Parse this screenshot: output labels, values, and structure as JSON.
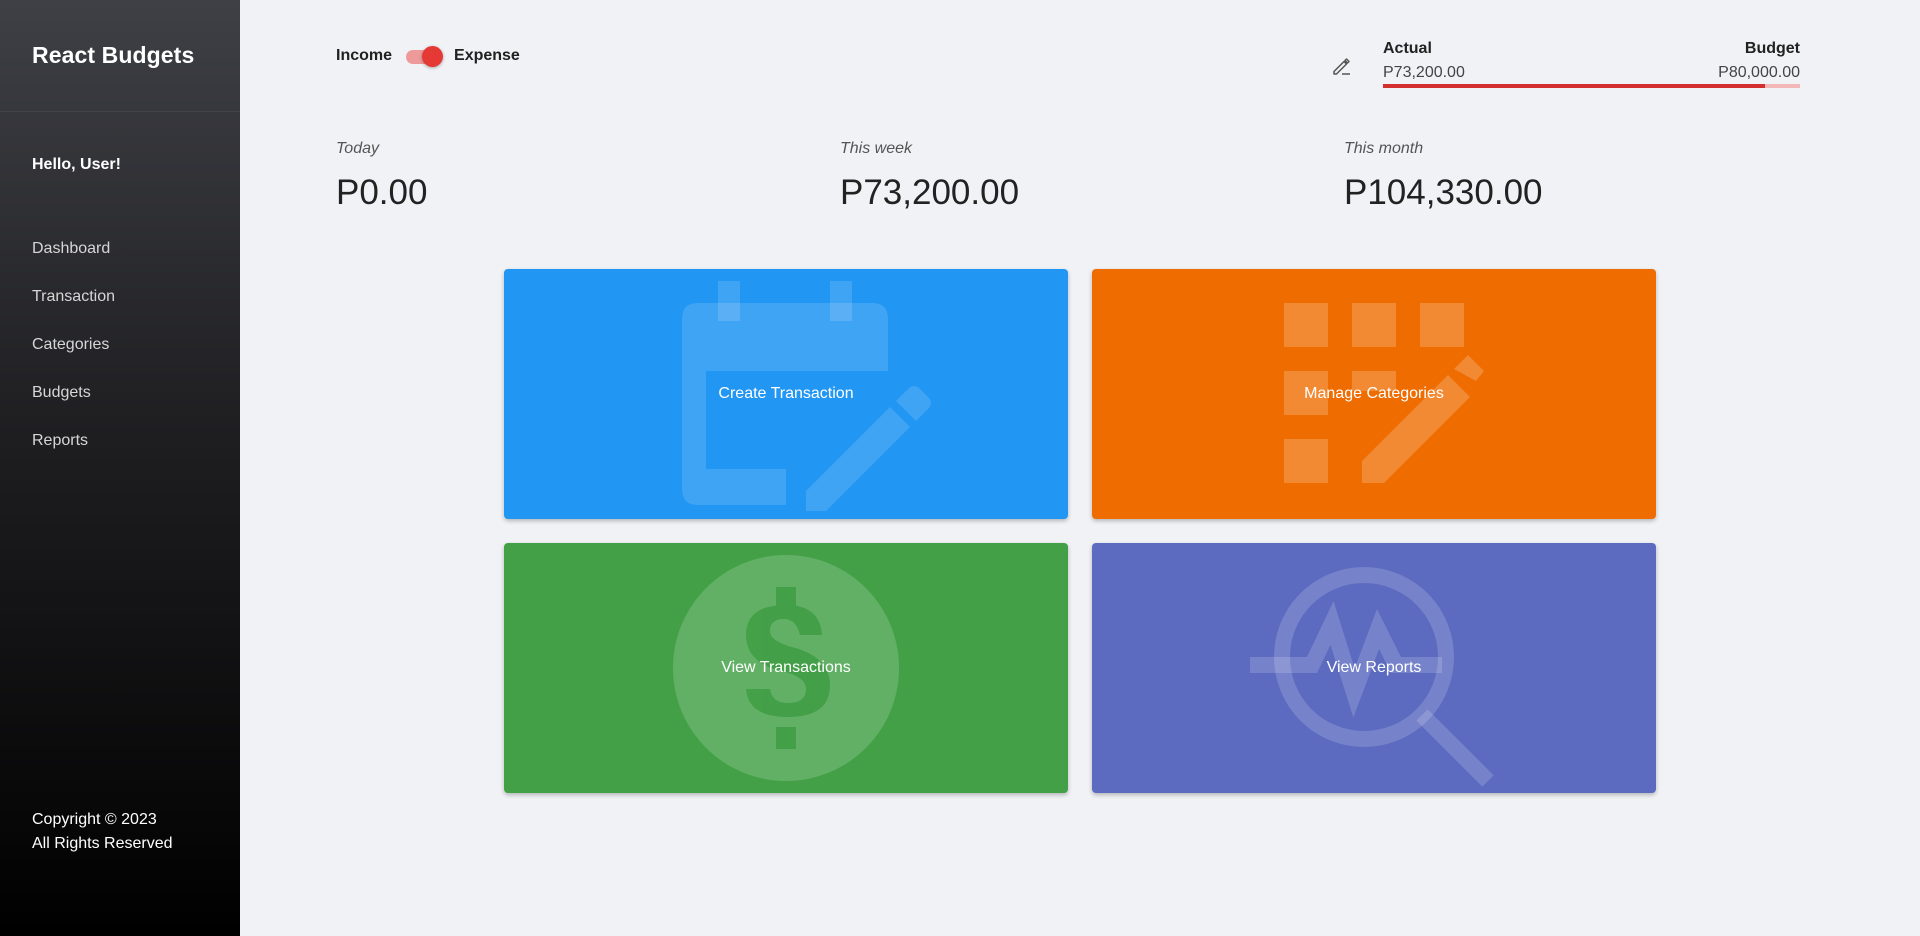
{
  "sidebar": {
    "brand": "React Budgets",
    "greeting": "Hello, User!",
    "nav": [
      "Dashboard",
      "Transaction",
      "Categories",
      "Budgets",
      "Reports"
    ],
    "copyright_line1": "Copyright © 2023",
    "copyright_line2": "All Rights Reserved"
  },
  "header": {
    "toggle": {
      "left_label": "Income",
      "right_label": "Expense",
      "state": "Expense"
    },
    "budget": {
      "actual_label": "Actual",
      "budget_label": "Budget",
      "actual_value": "P73,200.00",
      "budget_value": "P80,000.00",
      "progress_fraction": 0.915
    }
  },
  "stats": [
    {
      "period": "Today",
      "value": "P0.00"
    },
    {
      "period": "This week",
      "value": "P73,200.00"
    },
    {
      "period": "This month",
      "value": "P104,330.00"
    }
  ],
  "tiles": [
    {
      "label": "Create Transaction",
      "color": "#2196f3",
      "icon": "calendar-edit-icon"
    },
    {
      "label": "Manage Categories",
      "color": "#ef6c00",
      "icon": "grid-edit-icon"
    },
    {
      "label": "View Transactions",
      "color": "#43a047",
      "icon": "dollar-circle-icon"
    },
    {
      "label": "View Reports",
      "color": "#5c6bc0",
      "icon": "analytics-search-icon"
    }
  ],
  "colors": {
    "toggle_track": "#ef9a9a",
    "toggle_thumb": "#e53935",
    "budget_bar": "#d32f2f",
    "budget_bar_track": "#f4b7b7"
  }
}
